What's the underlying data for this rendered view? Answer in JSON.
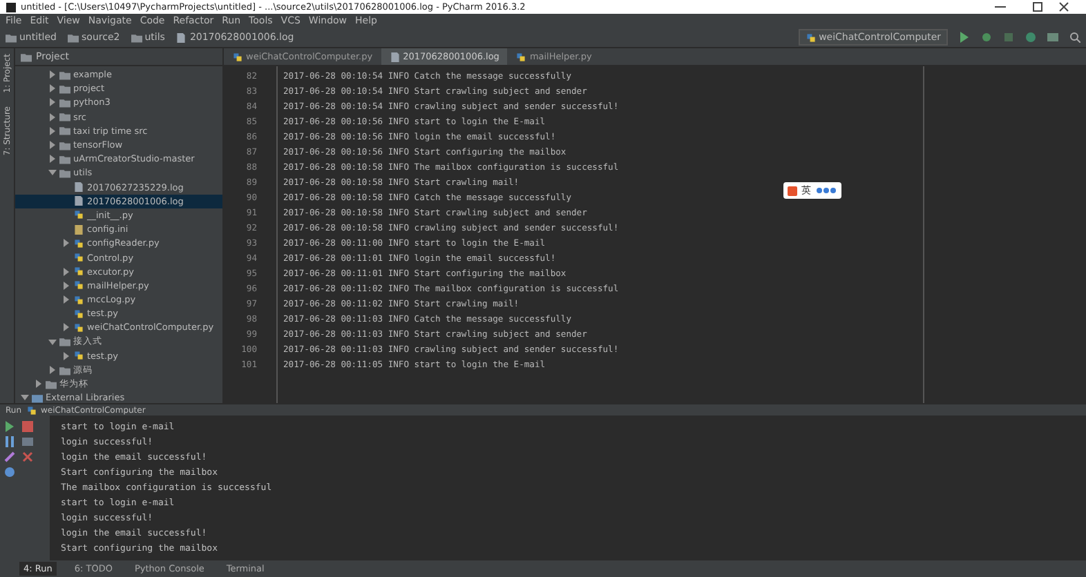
{
  "window": {
    "title": "untitled - [C:\\Users\\10497\\PycharmProjects\\untitled] - ...\\source2\\utils\\20170628001006.log - PyCharm 2016.3.2"
  },
  "menu": [
    "File",
    "Edit",
    "View",
    "Navigate",
    "Code",
    "Refactor",
    "Run",
    "Tools",
    "VCS",
    "Window",
    "Help"
  ],
  "breadcrumbs": [
    {
      "label": "untitled",
      "kind": "folder"
    },
    {
      "label": "source2",
      "kind": "folder"
    },
    {
      "label": "utils",
      "kind": "folder"
    },
    {
      "label": "20170628001006.log",
      "kind": "log"
    }
  ],
  "run_config": "weiChatControlComputer",
  "side_tabs": [
    "1: Project",
    "7: Structure"
  ],
  "project_header": "Project",
  "editor_tabs": [
    {
      "label": "weiChatControlComputer.py",
      "kind": "py",
      "selected": false
    },
    {
      "label": "20170628001006.log",
      "kind": "log",
      "selected": true
    },
    {
      "label": "mailHelper.py",
      "kind": "py",
      "selected": false
    }
  ],
  "tree": {
    "items": [
      {
        "label": "example",
        "kind": "folder",
        "expanded": false,
        "selected": false
      },
      {
        "label": "project",
        "kind": "folder",
        "expanded": false,
        "selected": false
      },
      {
        "label": "python3",
        "kind": "folder",
        "expanded": false,
        "selected": false
      },
      {
        "label": "src",
        "kind": "folder",
        "expanded": false,
        "selected": false
      },
      {
        "label": "taxi trip time src",
        "kind": "folder",
        "expanded": false,
        "selected": false
      },
      {
        "label": "tensorFlow",
        "kind": "folder",
        "expanded": false,
        "selected": false
      },
      {
        "label": "uArmCreatorStudio-master",
        "kind": "folder",
        "expanded": false,
        "selected": false
      },
      {
        "label": "utils",
        "kind": "folder",
        "expanded": true,
        "selected": false,
        "children": [
          {
            "label": "20170627235229.log",
            "kind": "log",
            "selected": false
          },
          {
            "label": "20170628001006.log",
            "kind": "log",
            "selected": true
          },
          {
            "label": "__init__.py",
            "kind": "py",
            "selected": false
          },
          {
            "label": "config.ini",
            "kind": "ini",
            "selected": false
          },
          {
            "label": "configReader.py",
            "kind": "py",
            "expanded": false,
            "selected": false
          },
          {
            "label": "Control.py",
            "kind": "py",
            "selected": false
          },
          {
            "label": "excutor.py",
            "kind": "py",
            "expanded": false,
            "selected": false
          },
          {
            "label": "mailHelper.py",
            "kind": "py",
            "expanded": false,
            "selected": false
          },
          {
            "label": "mccLog.py",
            "kind": "py",
            "expanded": false,
            "selected": false
          },
          {
            "label": "test.py",
            "kind": "py",
            "selected": false
          },
          {
            "label": "weiChatControlComputer.py",
            "kind": "py",
            "expanded": false,
            "selected": false
          }
        ]
      },
      {
        "label": "接入式",
        "kind": "folder",
        "expanded": true,
        "selected": false,
        "children": [
          {
            "label": "test.py",
            "kind": "py",
            "expanded": false,
            "selected": false
          }
        ]
      },
      {
        "label": "源码",
        "kind": "folder",
        "expanded": false,
        "selected": false
      }
    ],
    "outer_items": [
      {
        "label": "华为杯",
        "kind": "folder",
        "expanded": false,
        "selected": false
      }
    ],
    "libraries": {
      "label": "External Libraries",
      "kind": "library",
      "expanded": true,
      "selected": false
    }
  },
  "editor_lines": [
    {
      "number": "82",
      "text": "2017-06-28 00:10:54 INFO Catch the message successfully"
    },
    {
      "number": "83",
      "text": "2017-06-28 00:10:54 INFO Start crawling subject and sender"
    },
    {
      "number": "84",
      "text": "2017-06-28 00:10:54 INFO crawling subject and sender successful!"
    },
    {
      "number": "85",
      "text": "2017-06-28 00:10:56 INFO start to login the E-mail"
    },
    {
      "number": "86",
      "text": "2017-06-28 00:10:56 INFO login the email successful!"
    },
    {
      "number": "87",
      "text": "2017-06-28 00:10:56 INFO Start configuring the mailbox"
    },
    {
      "number": "88",
      "text": "2017-06-28 00:10:58 INFO The mailbox configuration is successful"
    },
    {
      "number": "89",
      "text": "2017-06-28 00:10:58 INFO Start crawling mail!"
    },
    {
      "number": "90",
      "text": "2017-06-28 00:10:58 INFO Catch the message successfully"
    },
    {
      "number": "91",
      "text": "2017-06-28 00:10:58 INFO Start crawling subject and sender"
    },
    {
      "number": "92",
      "text": "2017-06-28 00:10:58 INFO crawling subject and sender successful!"
    },
    {
      "number": "93",
      "text": "2017-06-28 00:11:00 INFO start to login the E-mail"
    },
    {
      "number": "94",
      "text": "2017-06-28 00:11:01 INFO login the email successful!"
    },
    {
      "number": "95",
      "text": "2017-06-28 00:11:01 INFO Start configuring the mailbox"
    },
    {
      "number": "96",
      "text": "2017-06-28 00:11:02 INFO The mailbox configuration is successful"
    },
    {
      "number": "97",
      "text": "2017-06-28 00:11:02 INFO Start crawling mail!"
    },
    {
      "number": "98",
      "text": "2017-06-28 00:11:03 INFO Catch the message successfully"
    },
    {
      "number": "99",
      "text": "2017-06-28 00:11:03 INFO Start crawling subject and sender"
    },
    {
      "number": "100",
      "text": "2017-06-28 00:11:03 INFO crawling subject and sender successful!"
    },
    {
      "number": "101",
      "text": "2017-06-28 00:11:05 INFO start to login the E-mail"
    }
  ],
  "ime": {
    "label": "英"
  },
  "run_panel": {
    "title": "Run",
    "config": "weiChatControlComputer"
  },
  "console_lines": [
    "start to login e-mail",
    "login successful!",
    "login the email successful!",
    "Start configuring the mailbox",
    "The mailbox configuration is successful",
    "start to login e-mail",
    "login successful!",
    "login the email successful!",
    "Start configuring the mailbox"
  ],
  "bottom_tabs": [
    {
      "label": "4: Run",
      "selected": true
    },
    {
      "label": "6: TODO",
      "selected": false
    },
    {
      "label": "Python Console",
      "selected": false
    },
    {
      "label": "Terminal",
      "selected": false
    }
  ]
}
